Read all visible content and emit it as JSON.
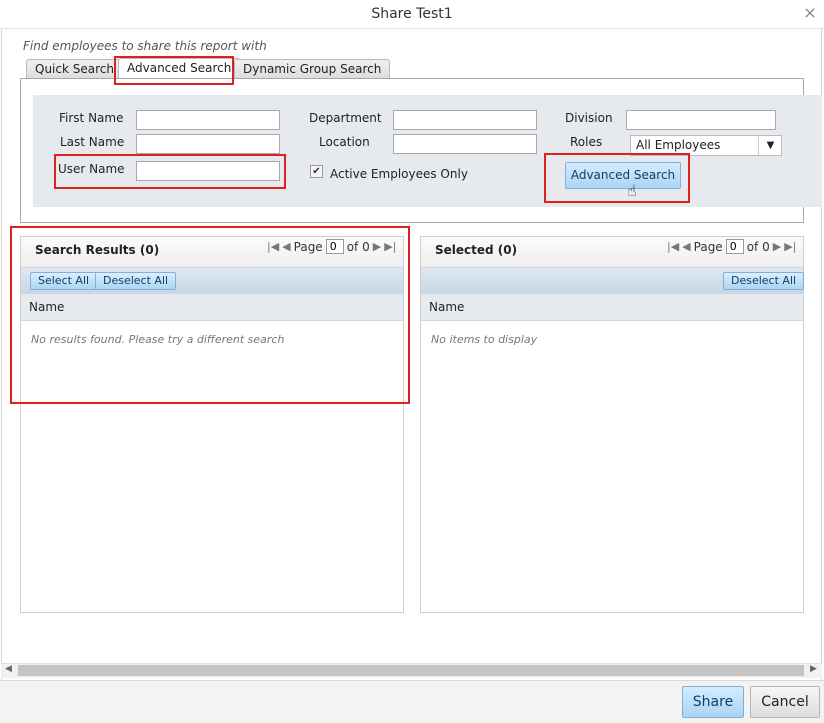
{
  "window": {
    "title": "Share Test1",
    "close_icon": "×"
  },
  "hint": "Find employees to share this report with",
  "tabs": [
    {
      "label": "Quick Search"
    },
    {
      "label": "Advanced Search",
      "active": true
    },
    {
      "label": "Dynamic Group Search"
    }
  ],
  "form": {
    "first_name_label": "First Name",
    "first_name_value": "",
    "last_name_label": "Last Name",
    "last_name_value": "",
    "user_name_label": "User Name",
    "user_name_value": "",
    "department_label": "Department",
    "department_value": "",
    "location_label": "Location",
    "location_value": "",
    "division_label": "Division",
    "division_value": "",
    "roles_label": "Roles",
    "roles_value": "All Employees",
    "active_only_label": "Active Employees Only",
    "active_only_checked": true,
    "search_button": "Advanced Search"
  },
  "results": {
    "title": "Search Results (0)",
    "page_label": "Page",
    "page_value": "0",
    "of_label": "of 0",
    "select_all": "Select All",
    "deselect_all": "Deselect All",
    "column": "Name",
    "empty": "No results found. Please try a different search"
  },
  "selected": {
    "title": "Selected (0)",
    "page_label": "Page",
    "page_value": "0",
    "of_label": "of 0",
    "deselect_all": "Deselect All",
    "column": "Name",
    "empty": "No items to display"
  },
  "footer": {
    "share": "Share",
    "cancel": "Cancel"
  },
  "colors": {
    "highlight": "#e02020",
    "button_blue": "#a9d4f5"
  },
  "icons": {
    "first_page": "first-page-icon",
    "prev_page": "prev-page-icon",
    "next_page": "next-page-icon",
    "last_page": "last-page-icon",
    "dropdown": "chevron-down-icon",
    "checkbox": "checkbox-checked-icon",
    "cursor": "hand-cursor-icon"
  }
}
